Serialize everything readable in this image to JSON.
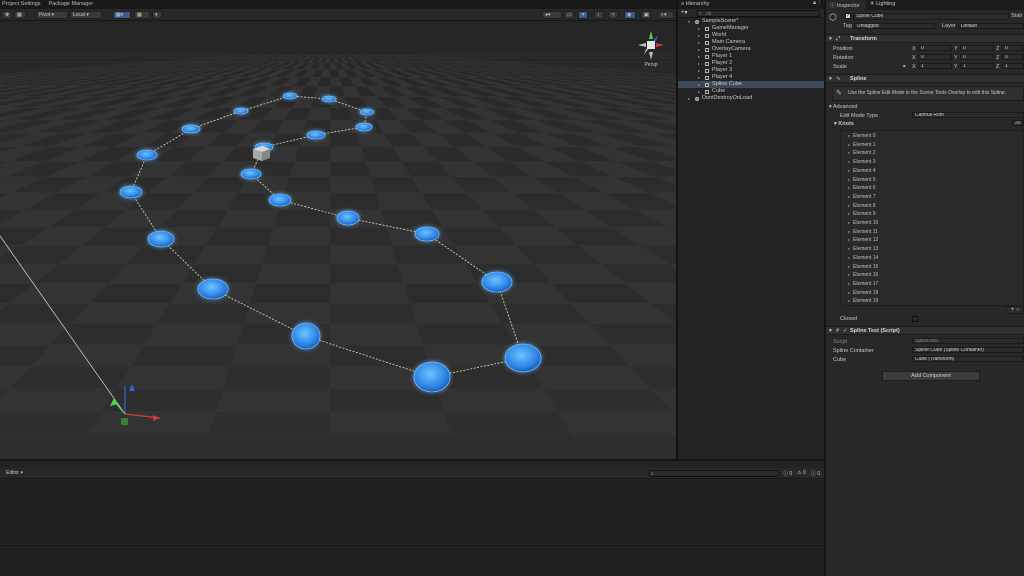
{
  "top_tabs": [
    "Project Settings",
    "Package Manager"
  ],
  "scene_toolbar": {
    "pivot_label": "Pivot",
    "space_label": "Local"
  },
  "gizmo": {
    "projection_label": "Persp"
  },
  "hierarchy": {
    "tab_label": "Hierarchy",
    "search_placeholder": "All",
    "rows": [
      {
        "label": "SampleScene*",
        "depth": 0,
        "expanded": true,
        "kind": "scene"
      },
      {
        "label": "GameManager",
        "depth": 1,
        "expanded": false,
        "kind": "object"
      },
      {
        "label": "World",
        "depth": 1,
        "expanded": false,
        "kind": "object"
      },
      {
        "label": "Main Camera",
        "depth": 1,
        "expanded": false,
        "kind": "object"
      },
      {
        "label": "OverlayCamera",
        "depth": 1,
        "expanded": false,
        "kind": "object"
      },
      {
        "label": "Player 1",
        "depth": 1,
        "expanded": false,
        "kind": "object"
      },
      {
        "label": "Player 2",
        "depth": 1,
        "expanded": false,
        "kind": "object"
      },
      {
        "label": "Player 3",
        "depth": 1,
        "expanded": false,
        "kind": "object"
      },
      {
        "label": "Player 4",
        "depth": 1,
        "expanded": false,
        "kind": "object"
      },
      {
        "label": "Spline Cube",
        "depth": 1,
        "expanded": false,
        "kind": "object",
        "selected": true
      },
      {
        "label": "Cube",
        "depth": 1,
        "expanded": false,
        "kind": "object"
      },
      {
        "label": "DontDestroyOnLoad",
        "depth": 0,
        "expanded": false,
        "kind": "scene"
      }
    ]
  },
  "inspector": {
    "tabs": [
      "Inspector",
      "Lighting"
    ],
    "object_name": "Spline Cube",
    "static_label": "Stati",
    "tag_label": "Tag",
    "tag_value": "Untagged",
    "layer_label": "Layer",
    "layer_value": "Default",
    "transform": {
      "title": "Transform",
      "rows": [
        {
          "label": "Position",
          "x": "0",
          "y": "0",
          "z": "0"
        },
        {
          "label": "Rotation",
          "x": "0",
          "y": "0",
          "z": "0"
        },
        {
          "label": "Scale",
          "x": "1",
          "y": "1",
          "z": "1"
        }
      ]
    },
    "spline": {
      "title": "Spline",
      "info_text": "Use the Spline Edit Mode in the Scene Tools Overlay to edit this Spline.",
      "advanced_label": "Advanced",
      "edit_mode_label": "Edit Mode Type",
      "edit_mode_value": "Catmull Rom",
      "knots_label": "Knots",
      "knots_count": "20",
      "elements": [
        "Element 0",
        "Element 1",
        "Element 2",
        "Element 3",
        "Element 4",
        "Element 5",
        "Element 6",
        "Element 7",
        "Element 8",
        "Element 9",
        "Element 10",
        "Element 11",
        "Element 12",
        "Element 13",
        "Element 14",
        "Element 15",
        "Element 16",
        "Element 17",
        "Element 18",
        "Element 19"
      ],
      "closed_label": "Closed"
    },
    "spline_test": {
      "title": "Spline Test (Script)",
      "script_label": "Script",
      "script_value": "SplineTest",
      "container_label": "Spline Container",
      "container_value": "Spline Cube (Spline Container)",
      "cube_label": "Cube",
      "cube_value": "Cube (Transform)"
    },
    "add_component_label": "Add Component"
  },
  "console": {
    "dropdown_label": "Editor",
    "counts": [
      "0",
      "0",
      "0"
    ]
  },
  "colors": {
    "knot_blue": "#2f86e8",
    "selection": "#3e4a5a",
    "panel": "#282828"
  }
}
